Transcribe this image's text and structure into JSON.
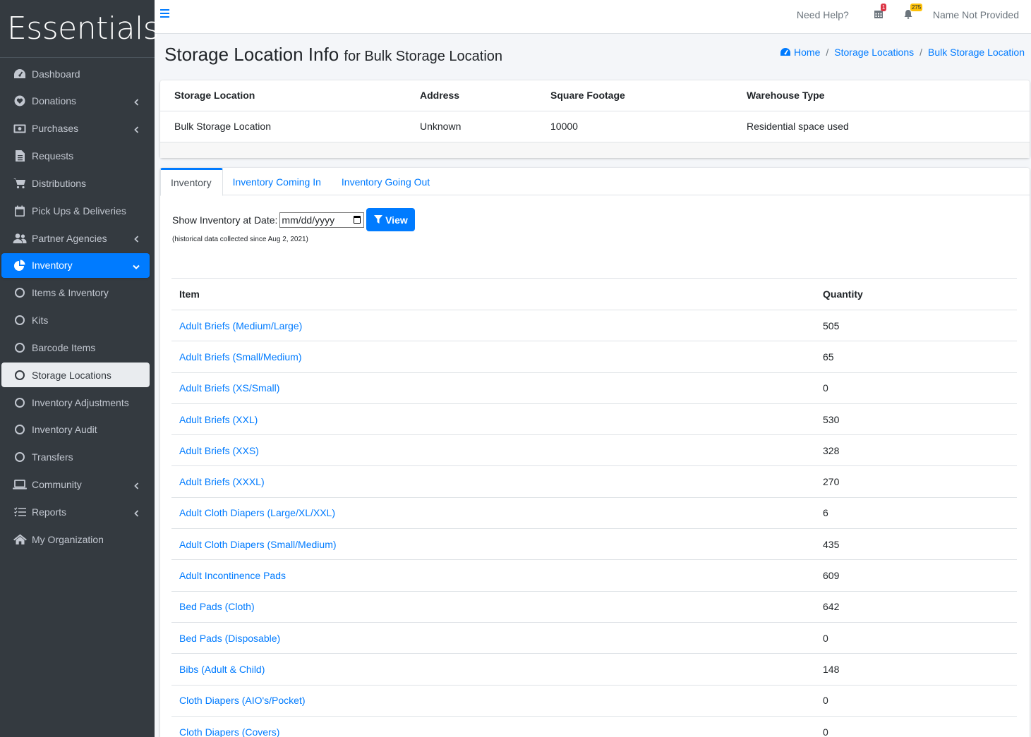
{
  "brand": "Essentials",
  "sidebar": {
    "items": [
      {
        "label": "Dashboard",
        "icon": "dashboard-icon"
      },
      {
        "label": "Donations",
        "icon": "donations-icon",
        "arrow": true
      },
      {
        "label": "Purchases",
        "icon": "money-icon",
        "arrow": true
      },
      {
        "label": "Requests",
        "icon": "file-icon"
      },
      {
        "label": "Distributions",
        "icon": "cart-icon"
      },
      {
        "label": "Pick Ups & Deliveries",
        "icon": "calendar-icon"
      },
      {
        "label": "Partner Agencies",
        "icon": "users-icon",
        "arrow": true
      },
      {
        "label": "Inventory",
        "icon": "pie-chart-icon",
        "arrow": true,
        "state": "active"
      },
      {
        "label": "Items & Inventory",
        "icon": "circle-icon"
      },
      {
        "label": "Kits",
        "icon": "circle-icon"
      },
      {
        "label": "Barcode Items",
        "icon": "circle-icon"
      },
      {
        "label": "Storage Locations",
        "icon": "circle-icon",
        "state": "current"
      },
      {
        "label": "Inventory Adjustments",
        "icon": "circle-icon"
      },
      {
        "label": "Inventory Audit",
        "icon": "circle-icon"
      },
      {
        "label": "Transfers",
        "icon": "circle-icon"
      },
      {
        "label": "Community",
        "icon": "laptop-icon",
        "arrow": true
      },
      {
        "label": "Reports",
        "icon": "list-icon",
        "arrow": true
      },
      {
        "label": "My Organization",
        "icon": "home-icon"
      }
    ]
  },
  "topbar": {
    "help": "Need Help?",
    "calendar_badge": "1",
    "bell_badge": "275",
    "user": "Name Not Provided"
  },
  "header": {
    "title": "Storage Location Info",
    "subtitle": "for Bulk Storage Location"
  },
  "breadcrumb": {
    "home": "Home",
    "storage_locations": "Storage Locations",
    "current": "Bulk Storage Location"
  },
  "info": {
    "headers": [
      "Storage Location",
      "Address",
      "Square Footage",
      "Warehouse Type"
    ],
    "values": [
      "Bulk Storage Location",
      "Unknown",
      "10000",
      "Residential space used"
    ]
  },
  "tabs": [
    "Inventory",
    "Inventory Coming In",
    "Inventory Going Out"
  ],
  "filter": {
    "label": "Show Inventory at Date:",
    "placeholder": "mm/dd/yyyy",
    "button": "View",
    "note": "(historical data collected since Aug 2, 2021)"
  },
  "inventory": {
    "headers": [
      "Item",
      "Quantity"
    ],
    "rows": [
      {
        "item": "Adult Briefs (Medium/Large)",
        "qty": "505"
      },
      {
        "item": "Adult Briefs (Small/Medium)",
        "qty": "65"
      },
      {
        "item": "Adult Briefs (XS/Small)",
        "qty": "0"
      },
      {
        "item": "Adult Briefs (XXL)",
        "qty": "530"
      },
      {
        "item": "Adult Briefs (XXS)",
        "qty": "328"
      },
      {
        "item": "Adult Briefs (XXXL)",
        "qty": "270"
      },
      {
        "item": "Adult Cloth Diapers (Large/XL/XXL)",
        "qty": "6"
      },
      {
        "item": "Adult Cloth Diapers (Small/Medium)",
        "qty": "435"
      },
      {
        "item": "Adult Incontinence Pads",
        "qty": "609"
      },
      {
        "item": "Bed Pads (Cloth)",
        "qty": "642"
      },
      {
        "item": "Bed Pads (Disposable)",
        "qty": "0"
      },
      {
        "item": "Bibs (Adult & Child)",
        "qty": "148"
      },
      {
        "item": "Cloth Diapers (AIO's/Pocket)",
        "qty": "0"
      },
      {
        "item": "Cloth Diapers (Covers)",
        "qty": "0"
      }
    ]
  }
}
